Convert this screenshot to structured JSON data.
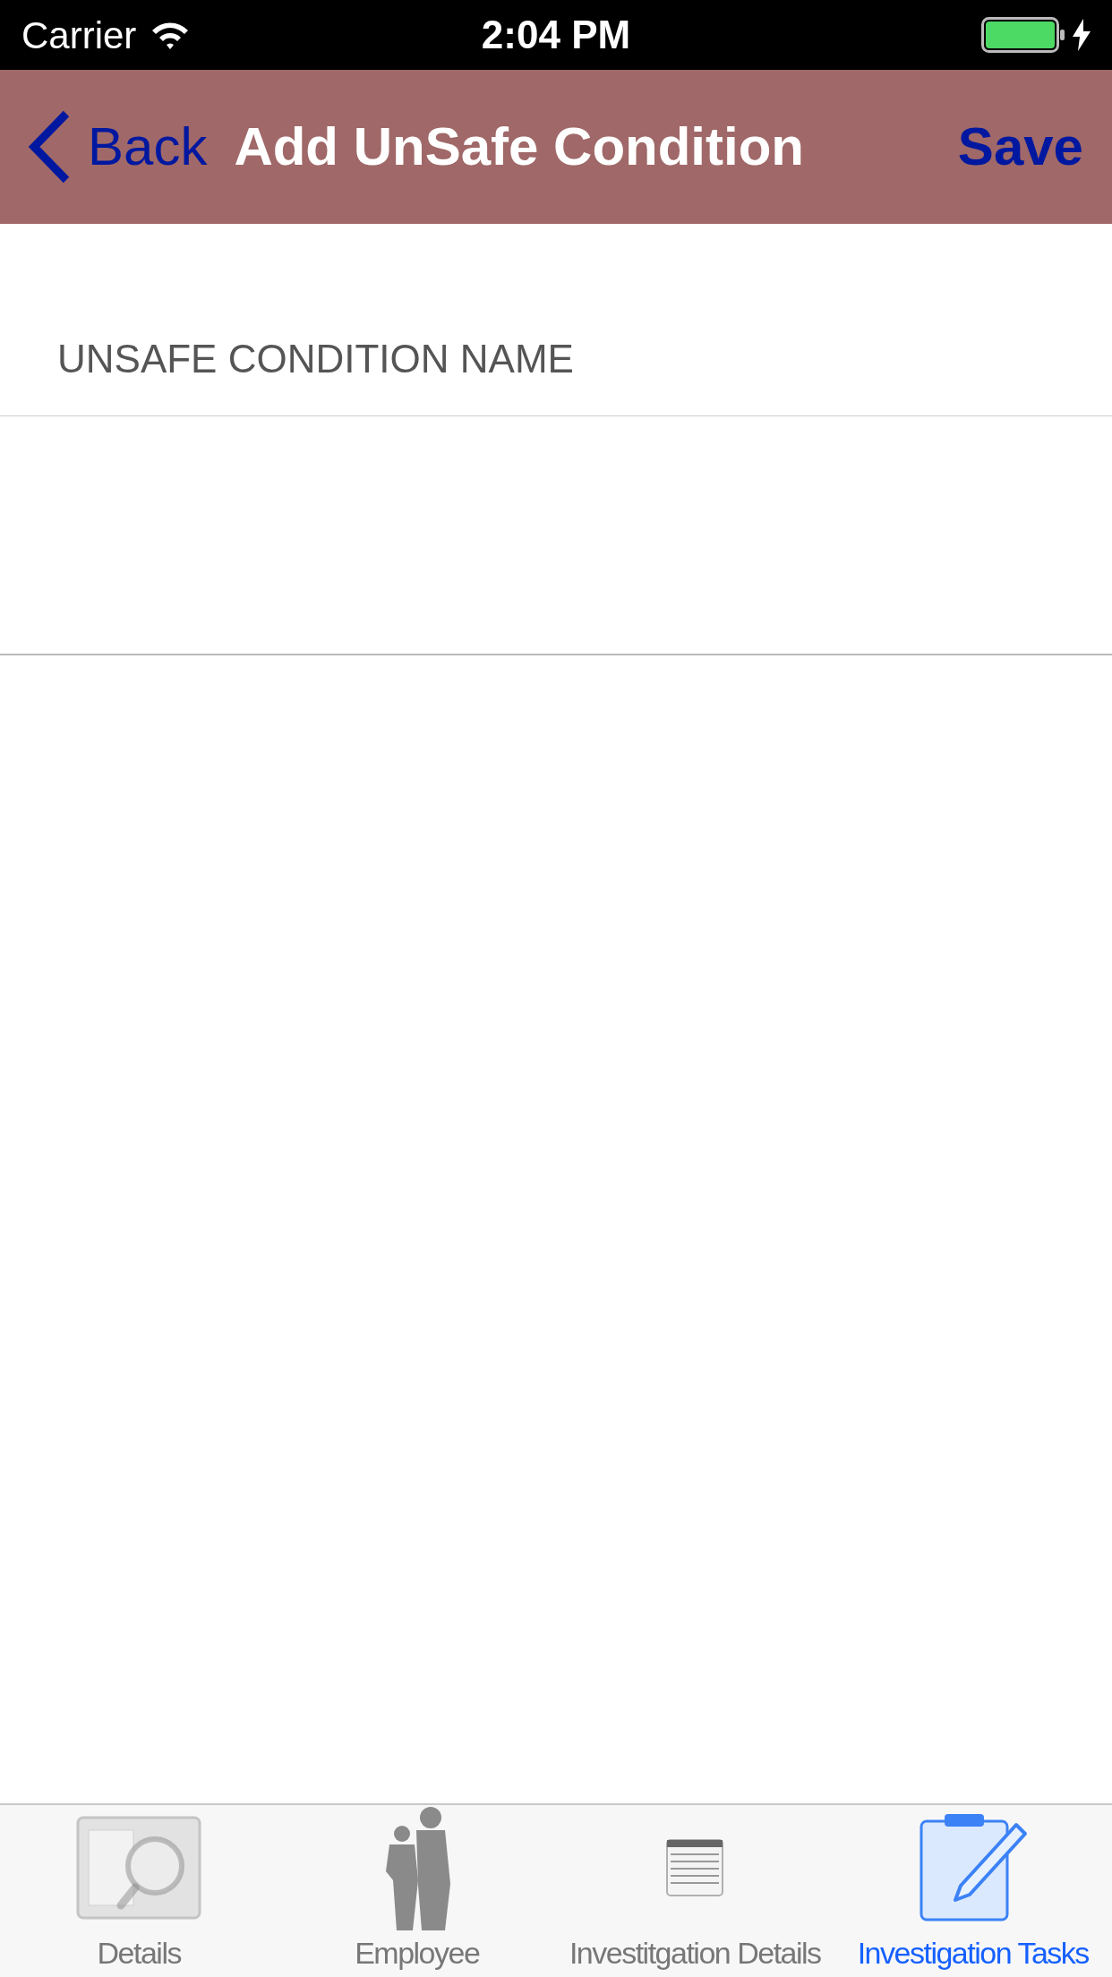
{
  "status_bar": {
    "carrier": "Carrier",
    "time": "2:04 PM"
  },
  "nav_bar": {
    "back": "Back",
    "title": "Add UnSafe Condition",
    "action": "Save"
  },
  "form": {
    "section_header": "UNSAFE CONDITION NAME"
  },
  "tab_bar": [
    {
      "label": "Details",
      "kind": "details",
      "selected": false
    },
    {
      "label": "Employee",
      "kind": "employee",
      "selected": false
    },
    {
      "label": "Investitgation Details",
      "kind": "list",
      "selected": false
    },
    {
      "label": "Investigation Tasks",
      "kind": "tasks",
      "selected": true
    }
  ]
}
